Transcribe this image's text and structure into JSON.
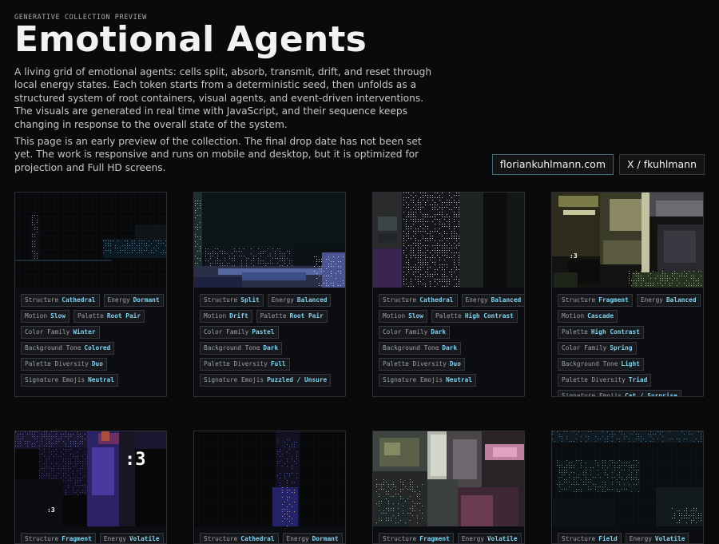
{
  "header": {
    "kicker": "GENERATIVE COLLECTION PREVIEW",
    "title": "Emotional Agents",
    "intro_1": "A living grid of emotional agents: cells split, absorb, transmit, drift, and reset through local energy states. Each token starts from a deterministic seed, then unfolds as a structured system of root containers, visual agents, and event-driven interventions. The visuals are generated in real time with JavaScript, and their sequence keeps changing in response to the overall state of the system.",
    "intro_2": "This page is an early preview of the collection. The final drop date has not been set yet. The work is responsive and runs on mobile and desktop, but it is optimized for projection and Full HD screens."
  },
  "links": {
    "website": "floriankuhlmann.com",
    "x": "X / fkuhlmann"
  },
  "cards": [
    {
      "art": "dark-dormant-grid",
      "art_text": "",
      "rows": [
        [
          [
            "Structure",
            "Cathedral"
          ],
          [
            "Energy",
            "Dormant"
          ]
        ],
        [
          [
            "Motion",
            "Slow"
          ],
          [
            "Palette",
            "Root Pair"
          ]
        ],
        [
          [
            "Color Family",
            "Winter"
          ]
        ],
        [
          [
            "Background Tone",
            "Colored"
          ]
        ],
        [
          [
            "Palette Diversity",
            "Duo"
          ]
        ],
        [
          [
            "Signature Emojis",
            "Neutral"
          ]
        ]
      ]
    },
    {
      "art": "split-pastel-blocks",
      "art_text": "",
      "rows": [
        [
          [
            "Structure",
            "Split"
          ],
          [
            "Energy",
            "Balanced"
          ]
        ],
        [
          [
            "Motion",
            "Drift"
          ],
          [
            "Palette",
            "Root Pair"
          ]
        ],
        [
          [
            "Color Family",
            "Pastel"
          ]
        ],
        [
          [
            "Background Tone",
            "Dark"
          ]
        ],
        [
          [
            "Palette Diversity",
            "Full"
          ]
        ],
        [
          [
            "Signature Emojis",
            "Puzzled / Unsure"
          ]
        ]
      ]
    },
    {
      "art": "cathedral-high-contrast",
      "art_text": "",
      "rows": [
        [
          [
            "Structure",
            "Cathedral"
          ],
          [
            "Energy",
            "Balanced"
          ]
        ],
        [
          [
            "Motion",
            "Slow"
          ],
          [
            "Palette",
            "High Contrast"
          ]
        ],
        [
          [
            "Color Family",
            "Dark"
          ]
        ],
        [
          [
            "Background Tone",
            "Dark"
          ]
        ],
        [
          [
            "Palette Diversity",
            "Duo"
          ]
        ],
        [
          [
            "Signature Emojis",
            "Neutral"
          ]
        ]
      ]
    },
    {
      "art": "fragment-spring",
      "art_text": ":3",
      "rows": [
        [
          [
            "Structure",
            "Fragment"
          ],
          [
            "Energy",
            "Balanced"
          ]
        ],
        [
          [
            "Motion",
            "Cascade"
          ]
        ],
        [
          [
            "Palette",
            "High Contrast"
          ]
        ],
        [
          [
            "Color Family",
            "Spring"
          ]
        ],
        [
          [
            "Background Tone",
            "Light"
          ]
        ],
        [
          [
            "Palette Diversity",
            "Triad"
          ]
        ],
        [
          [
            "Signature Emojis",
            "Cat / Surprise"
          ]
        ]
      ]
    },
    {
      "art": "fragment-volatile-violet",
      "art_text": ":3",
      "rows": [
        [
          [
            "Structure",
            "Fragment"
          ],
          [
            "Energy",
            "Volatile"
          ]
        ]
      ]
    },
    {
      "art": "cathedral-dormant-blue",
      "art_text": "",
      "rows": [
        [
          [
            "Structure",
            "Cathedral"
          ],
          [
            "Energy",
            "Dormant"
          ]
        ]
      ]
    },
    {
      "art": "fragment-volatile-pink",
      "art_text": "",
      "rows": [
        [
          [
            "Structure",
            "Fragment"
          ],
          [
            "Energy",
            "Volatile"
          ]
        ]
      ]
    },
    {
      "art": "field-volatile-teal",
      "art_text": "",
      "rows": [
        [
          [
            "Structure",
            "Field"
          ],
          [
            "Energy",
            "Volatile"
          ]
        ]
      ]
    }
  ]
}
